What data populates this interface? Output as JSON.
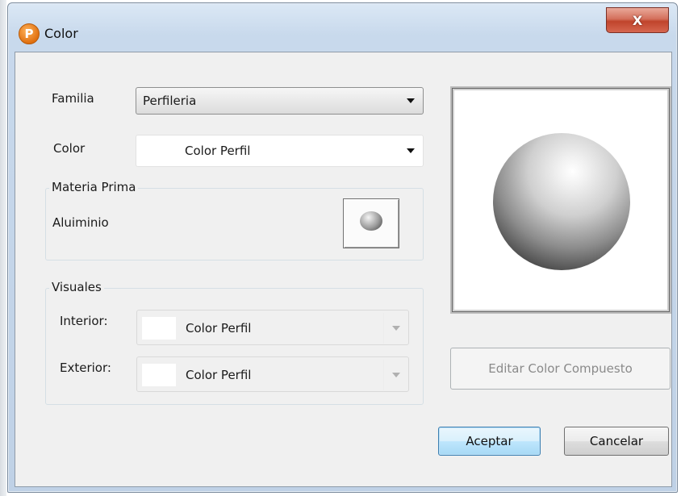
{
  "window": {
    "title": "Color",
    "app_icon_letter": "P",
    "close_glyph": "X"
  },
  "form": {
    "familia_label": "Familia",
    "familia_value": "Perfileria",
    "color_label": "Color",
    "color_value": "Color Perfil"
  },
  "materia_prima": {
    "title": "Materia Prima",
    "value": "Aluiminio"
  },
  "visuales": {
    "title": "Visuales",
    "interior_label": "Interior:",
    "interior_value": "Color Perfil",
    "exterior_label": "Exterior:",
    "exterior_value": "Color Perfil"
  },
  "buttons": {
    "edit_compound": "Editar Color Compuesto",
    "accept": "Aceptar",
    "cancel": "Cancelar"
  },
  "icons": {
    "app": "app-logo-icon",
    "close": "close-icon",
    "dropdown": "chevron-down-icon"
  },
  "colors": {
    "accent_button": "#a7d9f5",
    "close_button": "#c0442c",
    "dialog_bg": "#f0f0f0"
  }
}
